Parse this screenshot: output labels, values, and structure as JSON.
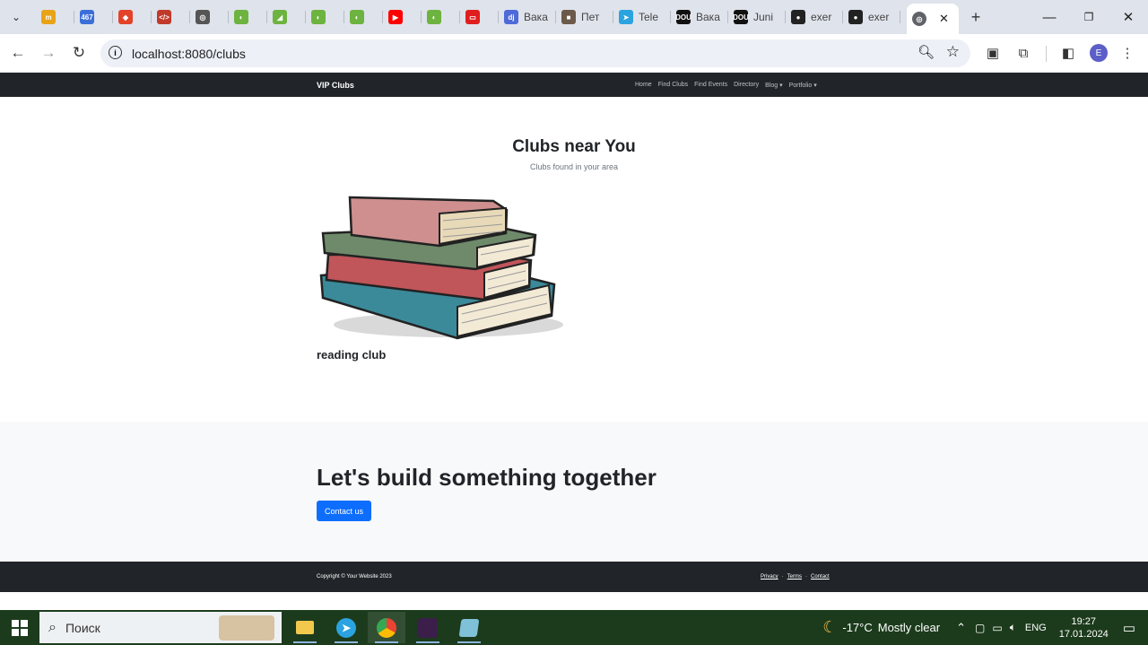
{
  "browser": {
    "tabs": [
      {
        "label": "",
        "fav": "m",
        "color": "#e8a317",
        "icon": "mosaic-icon"
      },
      {
        "label": "",
        "fav": "467",
        "color": "#3b6fd8",
        "icon": "calendar-icon"
      },
      {
        "label": "",
        "fav": "◆",
        "color": "#e24329",
        "icon": "gitlab-icon"
      },
      {
        "label": "",
        "fav": "</>",
        "color": "#c0392b",
        "icon": "code-icon"
      },
      {
        "label": "",
        "fav": "◎",
        "color": "#555555",
        "icon": "globe-icon"
      },
      {
        "label": "",
        "fav": "◐",
        "color": "#6db33f",
        "icon": "spring-icon"
      },
      {
        "label": "",
        "fav": "◢",
        "color": "#6db33f",
        "icon": "spring-guide-icon"
      },
      {
        "label": "",
        "fav": "◐",
        "color": "#6db33f",
        "icon": "spring-icon"
      },
      {
        "label": "",
        "fav": "◐",
        "color": "#6db33f",
        "icon": "spring-icon"
      },
      {
        "label": "",
        "fav": "▶",
        "color": "#ff0000",
        "icon": "youtube-icon"
      },
      {
        "label": "",
        "fav": "◐",
        "color": "#6db33f",
        "icon": "spring-icon"
      },
      {
        "label": "",
        "fav": "▭",
        "color": "#e01e1e",
        "icon": "oracle-icon"
      },
      {
        "label": "Вака",
        "fav": "dj",
        "color": "#4d6ad8",
        "icon": "djinni-icon"
      },
      {
        "label": "Пет",
        "fav": "■",
        "color": "#6b5a4a",
        "icon": "photo-icon"
      },
      {
        "label": "Tele",
        "fav": "➤",
        "color": "#2aa3e0",
        "icon": "telegram-icon"
      },
      {
        "label": "Вака",
        "fav": "DOU",
        "color": "#111111",
        "icon": "dou-icon"
      },
      {
        "label": "Juni",
        "fav": "DOU",
        "color": "#111111",
        "icon": "dou-icon"
      },
      {
        "label": "exer",
        "fav": "●",
        "color": "#222222",
        "icon": "github-icon"
      },
      {
        "label": "exer",
        "fav": "●",
        "color": "#222222",
        "icon": "github-icon"
      }
    ],
    "active_tab": {
      "label": "",
      "icon": "globe-icon"
    },
    "new_tab": "+",
    "url": "localhost:8080/clubs",
    "profile_initial": "E"
  },
  "site": {
    "brand": "VIP Clubs",
    "nav": [
      "Home",
      "Find Clubs",
      "Find Events",
      "Directory",
      "Blog ▾",
      "Portfolio ▾"
    ],
    "hero_title": "Clubs near You",
    "hero_subtitle": "Clubs found in your area",
    "club": {
      "name": "reading club",
      "image": "stack-of-books-illustration"
    },
    "cta_title": "Let's build something together",
    "cta_button": "Contact us",
    "copyright": "Copyright © Your Website 2023",
    "footer_links": [
      "Privacy",
      "Terms",
      "Contact"
    ],
    "footer_sep": "·"
  },
  "taskbar": {
    "search_placeholder": "Поиск",
    "weather_temp": "-17°C",
    "weather_text": "Mostly clear",
    "lang": "ENG",
    "time": "19:27",
    "date": "17.01.2024"
  }
}
